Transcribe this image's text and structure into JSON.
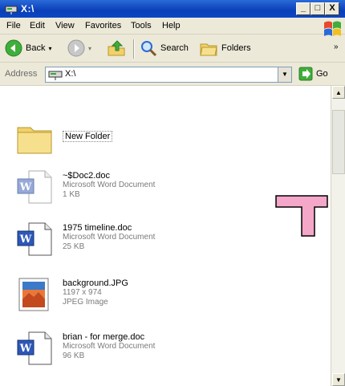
{
  "window": {
    "title": "X:\\"
  },
  "title_controls": {
    "minimize": "_",
    "maximize": "□",
    "close": "X"
  },
  "menu": [
    "File",
    "Edit",
    "View",
    "Favorites",
    "Tools",
    "Help"
  ],
  "toolbar": {
    "back_label": "Back",
    "search_label": "Search",
    "folders_label": "Folders",
    "overflow": "»"
  },
  "address": {
    "label": "Address",
    "value": "X:\\",
    "go_label": "Go"
  },
  "files": [
    {
      "name": "New Folder",
      "type": "",
      "size": "",
      "icon": "folder-icon"
    },
    {
      "name": "~$Doc2.doc",
      "type": "Microsoft Word Document",
      "size": "1 KB",
      "icon": "word-doc-icon"
    },
    {
      "name": "1975 timeline.doc",
      "type": "Microsoft Word Document",
      "size": "25 KB",
      "icon": "word-doc-icon"
    },
    {
      "name": "background.JPG",
      "type": "1197 x 974",
      "size": "JPEG Image",
      "icon": "jpeg-image-icon"
    },
    {
      "name": "brian - for merge.doc",
      "type": "Microsoft Word Document",
      "size": "96 KB",
      "icon": "word-doc-icon"
    }
  ],
  "colors": {
    "titlebar": "#0a3fb8",
    "overlay": "#f4a7c8"
  }
}
